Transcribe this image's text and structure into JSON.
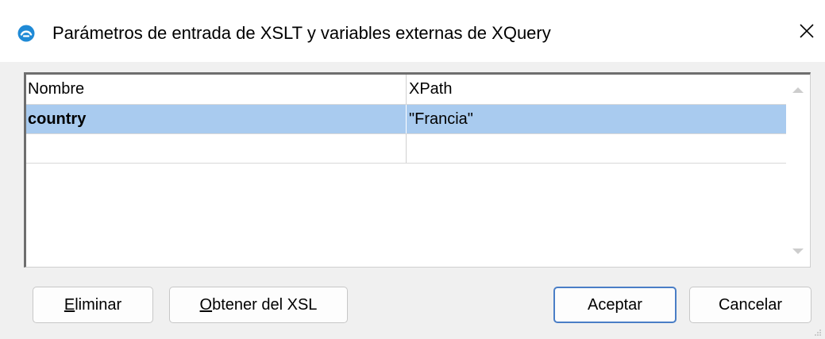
{
  "window": {
    "title": "Parámetros de entrada de XSLT y variables externas de XQuery",
    "close_icon": "close-icon",
    "app_icon": "altova-app-icon"
  },
  "grid": {
    "columns": [
      "Nombre",
      "XPath"
    ],
    "rows": [
      {
        "name": "country",
        "xpath": "\"Francia\"",
        "selected": true
      },
      {
        "name": "",
        "xpath": "",
        "selected": false
      }
    ],
    "selection_color": "#a9cbef"
  },
  "buttons": {
    "eliminar": {
      "accel": "E",
      "rest": "liminar"
    },
    "obtener": {
      "accel": "O",
      "rest": "btener del XSL"
    },
    "aceptar": "Aceptar",
    "cancelar": "Cancelar"
  },
  "colors": {
    "accent": "#4a7ec6",
    "app_icon": "#1f8ad6"
  }
}
